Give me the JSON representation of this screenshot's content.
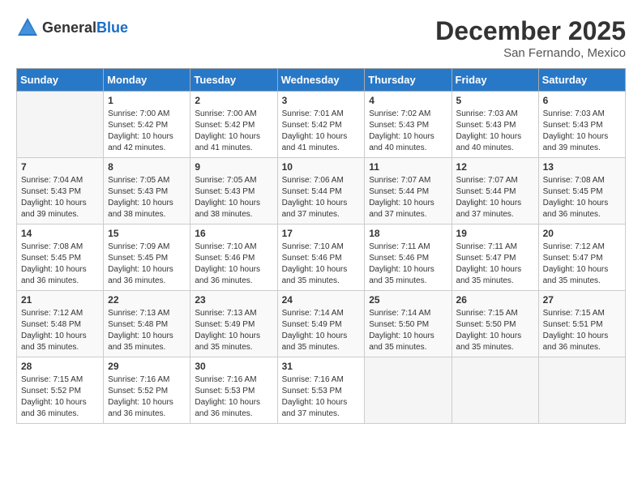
{
  "logo": {
    "general": "General",
    "blue": "Blue"
  },
  "header": {
    "title": "December 2025",
    "location": "San Fernando, Mexico"
  },
  "weekdays": [
    "Sunday",
    "Monday",
    "Tuesday",
    "Wednesday",
    "Thursday",
    "Friday",
    "Saturday"
  ],
  "weeks": [
    [
      {
        "day": "",
        "sunrise": "",
        "sunset": "",
        "daylight": ""
      },
      {
        "day": "1",
        "sunrise": "Sunrise: 7:00 AM",
        "sunset": "Sunset: 5:42 PM",
        "daylight": "Daylight: 10 hours and 42 minutes."
      },
      {
        "day": "2",
        "sunrise": "Sunrise: 7:00 AM",
        "sunset": "Sunset: 5:42 PM",
        "daylight": "Daylight: 10 hours and 41 minutes."
      },
      {
        "day": "3",
        "sunrise": "Sunrise: 7:01 AM",
        "sunset": "Sunset: 5:42 PM",
        "daylight": "Daylight: 10 hours and 41 minutes."
      },
      {
        "day": "4",
        "sunrise": "Sunrise: 7:02 AM",
        "sunset": "Sunset: 5:43 PM",
        "daylight": "Daylight: 10 hours and 40 minutes."
      },
      {
        "day": "5",
        "sunrise": "Sunrise: 7:03 AM",
        "sunset": "Sunset: 5:43 PM",
        "daylight": "Daylight: 10 hours and 40 minutes."
      },
      {
        "day": "6",
        "sunrise": "Sunrise: 7:03 AM",
        "sunset": "Sunset: 5:43 PM",
        "daylight": "Daylight: 10 hours and 39 minutes."
      }
    ],
    [
      {
        "day": "7",
        "sunrise": "Sunrise: 7:04 AM",
        "sunset": "Sunset: 5:43 PM",
        "daylight": "Daylight: 10 hours and 39 minutes."
      },
      {
        "day": "8",
        "sunrise": "Sunrise: 7:05 AM",
        "sunset": "Sunset: 5:43 PM",
        "daylight": "Daylight: 10 hours and 38 minutes."
      },
      {
        "day": "9",
        "sunrise": "Sunrise: 7:05 AM",
        "sunset": "Sunset: 5:43 PM",
        "daylight": "Daylight: 10 hours and 38 minutes."
      },
      {
        "day": "10",
        "sunrise": "Sunrise: 7:06 AM",
        "sunset": "Sunset: 5:44 PM",
        "daylight": "Daylight: 10 hours and 37 minutes."
      },
      {
        "day": "11",
        "sunrise": "Sunrise: 7:07 AM",
        "sunset": "Sunset: 5:44 PM",
        "daylight": "Daylight: 10 hours and 37 minutes."
      },
      {
        "day": "12",
        "sunrise": "Sunrise: 7:07 AM",
        "sunset": "Sunset: 5:44 PM",
        "daylight": "Daylight: 10 hours and 37 minutes."
      },
      {
        "day": "13",
        "sunrise": "Sunrise: 7:08 AM",
        "sunset": "Sunset: 5:45 PM",
        "daylight": "Daylight: 10 hours and 36 minutes."
      }
    ],
    [
      {
        "day": "14",
        "sunrise": "Sunrise: 7:08 AM",
        "sunset": "Sunset: 5:45 PM",
        "daylight": "Daylight: 10 hours and 36 minutes."
      },
      {
        "day": "15",
        "sunrise": "Sunrise: 7:09 AM",
        "sunset": "Sunset: 5:45 PM",
        "daylight": "Daylight: 10 hours and 36 minutes."
      },
      {
        "day": "16",
        "sunrise": "Sunrise: 7:10 AM",
        "sunset": "Sunset: 5:46 PM",
        "daylight": "Daylight: 10 hours and 36 minutes."
      },
      {
        "day": "17",
        "sunrise": "Sunrise: 7:10 AM",
        "sunset": "Sunset: 5:46 PM",
        "daylight": "Daylight: 10 hours and 35 minutes."
      },
      {
        "day": "18",
        "sunrise": "Sunrise: 7:11 AM",
        "sunset": "Sunset: 5:46 PM",
        "daylight": "Daylight: 10 hours and 35 minutes."
      },
      {
        "day": "19",
        "sunrise": "Sunrise: 7:11 AM",
        "sunset": "Sunset: 5:47 PM",
        "daylight": "Daylight: 10 hours and 35 minutes."
      },
      {
        "day": "20",
        "sunrise": "Sunrise: 7:12 AM",
        "sunset": "Sunset: 5:47 PM",
        "daylight": "Daylight: 10 hours and 35 minutes."
      }
    ],
    [
      {
        "day": "21",
        "sunrise": "Sunrise: 7:12 AM",
        "sunset": "Sunset: 5:48 PM",
        "daylight": "Daylight: 10 hours and 35 minutes."
      },
      {
        "day": "22",
        "sunrise": "Sunrise: 7:13 AM",
        "sunset": "Sunset: 5:48 PM",
        "daylight": "Daylight: 10 hours and 35 minutes."
      },
      {
        "day": "23",
        "sunrise": "Sunrise: 7:13 AM",
        "sunset": "Sunset: 5:49 PM",
        "daylight": "Daylight: 10 hours and 35 minutes."
      },
      {
        "day": "24",
        "sunrise": "Sunrise: 7:14 AM",
        "sunset": "Sunset: 5:49 PM",
        "daylight": "Daylight: 10 hours and 35 minutes."
      },
      {
        "day": "25",
        "sunrise": "Sunrise: 7:14 AM",
        "sunset": "Sunset: 5:50 PM",
        "daylight": "Daylight: 10 hours and 35 minutes."
      },
      {
        "day": "26",
        "sunrise": "Sunrise: 7:15 AM",
        "sunset": "Sunset: 5:50 PM",
        "daylight": "Daylight: 10 hours and 35 minutes."
      },
      {
        "day": "27",
        "sunrise": "Sunrise: 7:15 AM",
        "sunset": "Sunset: 5:51 PM",
        "daylight": "Daylight: 10 hours and 36 minutes."
      }
    ],
    [
      {
        "day": "28",
        "sunrise": "Sunrise: 7:15 AM",
        "sunset": "Sunset: 5:52 PM",
        "daylight": "Daylight: 10 hours and 36 minutes."
      },
      {
        "day": "29",
        "sunrise": "Sunrise: 7:16 AM",
        "sunset": "Sunset: 5:52 PM",
        "daylight": "Daylight: 10 hours and 36 minutes."
      },
      {
        "day": "30",
        "sunrise": "Sunrise: 7:16 AM",
        "sunset": "Sunset: 5:53 PM",
        "daylight": "Daylight: 10 hours and 36 minutes."
      },
      {
        "day": "31",
        "sunrise": "Sunrise: 7:16 AM",
        "sunset": "Sunset: 5:53 PM",
        "daylight": "Daylight: 10 hours and 37 minutes."
      },
      {
        "day": "",
        "sunrise": "",
        "sunset": "",
        "daylight": ""
      },
      {
        "day": "",
        "sunrise": "",
        "sunset": "",
        "daylight": ""
      },
      {
        "day": "",
        "sunrise": "",
        "sunset": "",
        "daylight": ""
      }
    ]
  ]
}
